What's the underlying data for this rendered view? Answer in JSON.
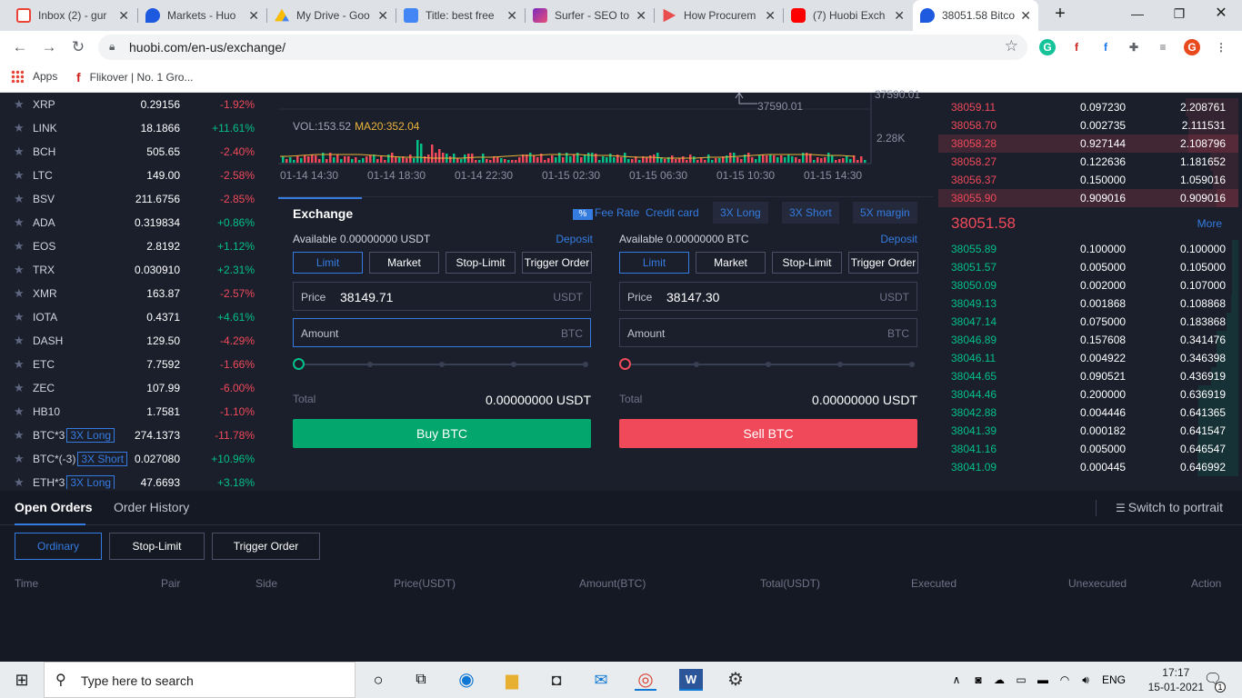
{
  "browser": {
    "tabs": [
      {
        "title": "Inbox (2) - gur",
        "color": "#ea4335"
      },
      {
        "title": "Markets - Huo",
        "color": "#1e5ae0"
      },
      {
        "title": "My Drive - Goo",
        "color": "#fbbc04"
      },
      {
        "title": "Title: best free",
        "color": "#4285f4"
      },
      {
        "title": "Surfer - SEO to",
        "color": "#7b2cbf"
      },
      {
        "title": "How Procurem",
        "color": "#e94e4e"
      },
      {
        "title": "(7) Huobi Exch",
        "color": "#ff0000"
      },
      {
        "title": "38051.58 Bitco",
        "color": "#1e5ae0"
      }
    ],
    "new_tab": "+",
    "url": "huobi.com/en-us/exchange/",
    "bookmarks": [
      {
        "label": "Apps"
      },
      {
        "label": "Flikover | No. 1 Gro..."
      }
    ]
  },
  "market": {
    "rows": [
      {
        "sym": "XRP",
        "lev": "",
        "price": "0.29156",
        "change": "-1.92%",
        "dir": "dn"
      },
      {
        "sym": "LINK",
        "lev": "",
        "price": "18.1866",
        "change": "+11.61%",
        "dir": "up"
      },
      {
        "sym": "BCH",
        "lev": "",
        "price": "505.65",
        "change": "-2.40%",
        "dir": "dn"
      },
      {
        "sym": "LTC",
        "lev": "",
        "price": "149.00",
        "change": "-2.58%",
        "dir": "dn"
      },
      {
        "sym": "BSV",
        "lev": "",
        "price": "211.6756",
        "change": "-2.85%",
        "dir": "dn"
      },
      {
        "sym": "ADA",
        "lev": "",
        "price": "0.319834",
        "change": "+0.86%",
        "dir": "up"
      },
      {
        "sym": "EOS",
        "lev": "",
        "price": "2.8192",
        "change": "+1.12%",
        "dir": "up"
      },
      {
        "sym": "TRX",
        "lev": "",
        "price": "0.030910",
        "change": "+2.31%",
        "dir": "up"
      },
      {
        "sym": "XMR",
        "lev": "",
        "price": "163.87",
        "change": "-2.57%",
        "dir": "dn"
      },
      {
        "sym": "IOTA",
        "lev": "",
        "price": "0.4371",
        "change": "+4.61%",
        "dir": "up"
      },
      {
        "sym": "DASH",
        "lev": "",
        "price": "129.50",
        "change": "-4.29%",
        "dir": "dn"
      },
      {
        "sym": "ETC",
        "lev": "",
        "price": "7.7592",
        "change": "-1.66%",
        "dir": "dn"
      },
      {
        "sym": "ZEC",
        "lev": "",
        "price": "107.99",
        "change": "-6.00%",
        "dir": "dn"
      },
      {
        "sym": "HB10",
        "lev": "",
        "price": "1.7581",
        "change": "-1.10%",
        "dir": "dn"
      },
      {
        "sym": "BTC*3",
        "lev": "3X Long",
        "price": "274.1373",
        "change": "-11.78%",
        "dir": "dn"
      },
      {
        "sym": "BTC*(-3)",
        "lev": "3X Short",
        "price": "0.027080",
        "change": "+10.96%",
        "dir": "up"
      },
      {
        "sym": "ETH*3",
        "lev": "3X Long",
        "price": "47.6693",
        "change": "+3.18%",
        "dir": "up"
      }
    ]
  },
  "chart": {
    "vol_label": "VOL:153.52",
    "ma_label": "MA20:352.04",
    "low_marker": "37590.01",
    "axis_top": "37590.01",
    "axis_vol": "2.28K",
    "xticks": [
      "01-14 14:30",
      "01-14 18:30",
      "01-14 22:30",
      "01-15 02:30",
      "01-15 06:30",
      "01-15 10:30",
      "01-15 14:30"
    ]
  },
  "exchange": {
    "title": "Exchange",
    "fee_icon": "%",
    "fee_rate": "Fee Rate",
    "credit_card": "Credit card",
    "long3x": "3X Long",
    "short3x": "3X Short",
    "margin5x": "5X margin",
    "order_types": [
      "Limit",
      "Market",
      "Stop-Limit",
      "Trigger Order"
    ],
    "buy": {
      "available": "Available  0.00000000 USDT",
      "deposit": "Deposit",
      "price_label": "Price",
      "price": "38149.71",
      "price_unit": "USDT",
      "amount_label": "Amount",
      "amount_unit": "BTC",
      "total_label": "Total",
      "total": "0.00000000 USDT",
      "button": "Buy BTC"
    },
    "sell": {
      "available": "Available  0.00000000 BTC",
      "deposit": "Deposit",
      "price_label": "Price",
      "price": "38147.30",
      "price_unit": "USDT",
      "amount_label": "Amount",
      "amount_unit": "BTC",
      "total_label": "Total",
      "total": "0.00000000 USDT",
      "button": "Sell BTC"
    }
  },
  "orderbook": {
    "asks": [
      {
        "price": "38059.11",
        "amount": "0.097230",
        "total": "2.208761"
      },
      {
        "price": "38058.70",
        "amount": "0.002735",
        "total": "2.111531"
      },
      {
        "price": "38058.28",
        "amount": "0.927144",
        "total": "2.108796"
      },
      {
        "price": "38058.27",
        "amount": "0.122636",
        "total": "1.181652"
      },
      {
        "price": "38056.37",
        "amount": "0.150000",
        "total": "1.059016"
      },
      {
        "price": "38055.90",
        "amount": "0.909016",
        "total": "0.909016"
      }
    ],
    "last_price": "38051.58",
    "more": "More",
    "bids": [
      {
        "price": "38055.89",
        "amount": "0.100000",
        "total": "0.100000"
      },
      {
        "price": "38051.57",
        "amount": "0.005000",
        "total": "0.105000"
      },
      {
        "price": "38050.09",
        "amount": "0.002000",
        "total": "0.107000"
      },
      {
        "price": "38049.13",
        "amount": "0.001868",
        "total": "0.108868"
      },
      {
        "price": "38047.14",
        "amount": "0.075000",
        "total": "0.183868"
      },
      {
        "price": "38046.89",
        "amount": "0.157608",
        "total": "0.341476"
      },
      {
        "price": "38046.11",
        "amount": "0.004922",
        "total": "0.346398"
      },
      {
        "price": "38044.65",
        "amount": "0.090521",
        "total": "0.436919"
      },
      {
        "price": "38044.46",
        "amount": "0.200000",
        "total": "0.636919"
      },
      {
        "price": "38042.88",
        "amount": "0.004446",
        "total": "0.641365"
      },
      {
        "price": "38041.39",
        "amount": "0.000182",
        "total": "0.641547"
      },
      {
        "price": "38041.16",
        "amount": "0.005000",
        "total": "0.646547"
      },
      {
        "price": "38041.09",
        "amount": "0.000445",
        "total": "0.646992"
      }
    ]
  },
  "orders": {
    "tab_open": "Open Orders",
    "tab_history": "Order History",
    "portrait": "Switch to portrait",
    "filters": [
      "Ordinary",
      "Stop-Limit",
      "Trigger Order"
    ],
    "columns": [
      "Time",
      "Pair",
      "Side",
      "Price(USDT)",
      "Amount(BTC)",
      "Total(USDT)",
      "Executed",
      "Unexecuted",
      "Action"
    ]
  },
  "taskbar": {
    "search_placeholder": "Type here to search",
    "lang": "ENG",
    "time": "17:17",
    "date": "15-01-2021",
    "notif_count": "1"
  },
  "colors": {
    "up": "#03c087",
    "down": "#f04a5a",
    "accent": "#357ce1",
    "bg": "#1b1f2c"
  }
}
